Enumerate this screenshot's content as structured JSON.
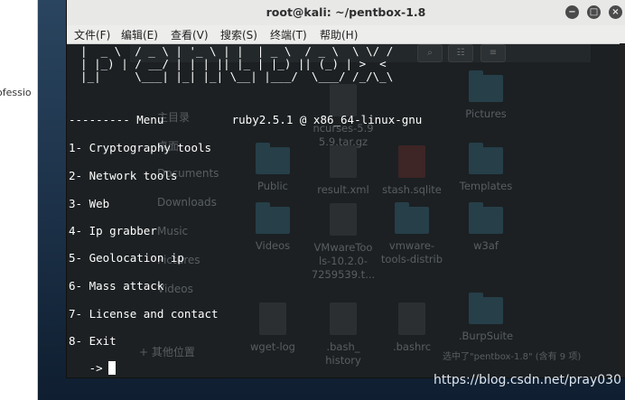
{
  "left_panel": {
    "fragment": "ofessio"
  },
  "window": {
    "title": "root@kali: ~/pentbox-1.8",
    "buttons": {
      "minimize": "−",
      "maximize": "□",
      "close": "×"
    }
  },
  "menubar": [
    {
      "label": "文件(F)"
    },
    {
      "label": "编辑(E)"
    },
    {
      "label": "查看(V)"
    },
    {
      "label": "搜索(S)"
    },
    {
      "label": "终端(T)"
    },
    {
      "label": "帮助(H)"
    }
  ],
  "banner": [
    "  |  _ \\  / _ \\ | '_ \\ | |  | _ \\  / _ \\  \\ \\/ /",
    "  | |_) | / __/ | | | || |_ | |_) || (_) | >  < ",
    "  |_|     \\___| |_| |_| \\__| |___/  \\___/ /_/\\_\\"
  ],
  "menu_header": "--------- Menu          ruby2.5.1 @ x86_64-linux-gnu",
  "menu_items": [
    "1- Cryptography tools",
    "2- Network tools",
    "3- Web",
    "4- Ip grabber",
    "5- Geolocation ip",
    "6- Mass attack",
    "7- License and contact",
    "8- Exit"
  ],
  "prompt": "   -> ",
  "ghost": {
    "sidebar": [
      "主目录",
      "桌面",
      "Documents",
      "Downloads",
      "Music",
      "Pictures",
      "Videos",
      "+ 其他位置"
    ],
    "items": [
      {
        "label": "ncurses-5.9\n5.9.tar.gz"
      },
      {
        "label": "Pictures"
      },
      {
        "label": "Public"
      },
      {
        "label": "result.xml"
      },
      {
        "label": "stash.sqlite"
      },
      {
        "label": "Templates"
      },
      {
        "label": "Videos"
      },
      {
        "label": "VMwareToo\nls-10.2.0-\n7259539.t..."
      },
      {
        "label": "vmware-\ntools-distrib"
      },
      {
        "label": "w3af"
      },
      {
        "label": "wget-log"
      },
      {
        "label": ".bash_\nhistory"
      },
      {
        "label": ".bashrc"
      },
      {
        "label": ".BurpSuite"
      }
    ],
    "status": "选中了\"pentbox-1.8\" (含有 9 项)"
  },
  "watermark": "https://blog.csdn.net/pray030"
}
